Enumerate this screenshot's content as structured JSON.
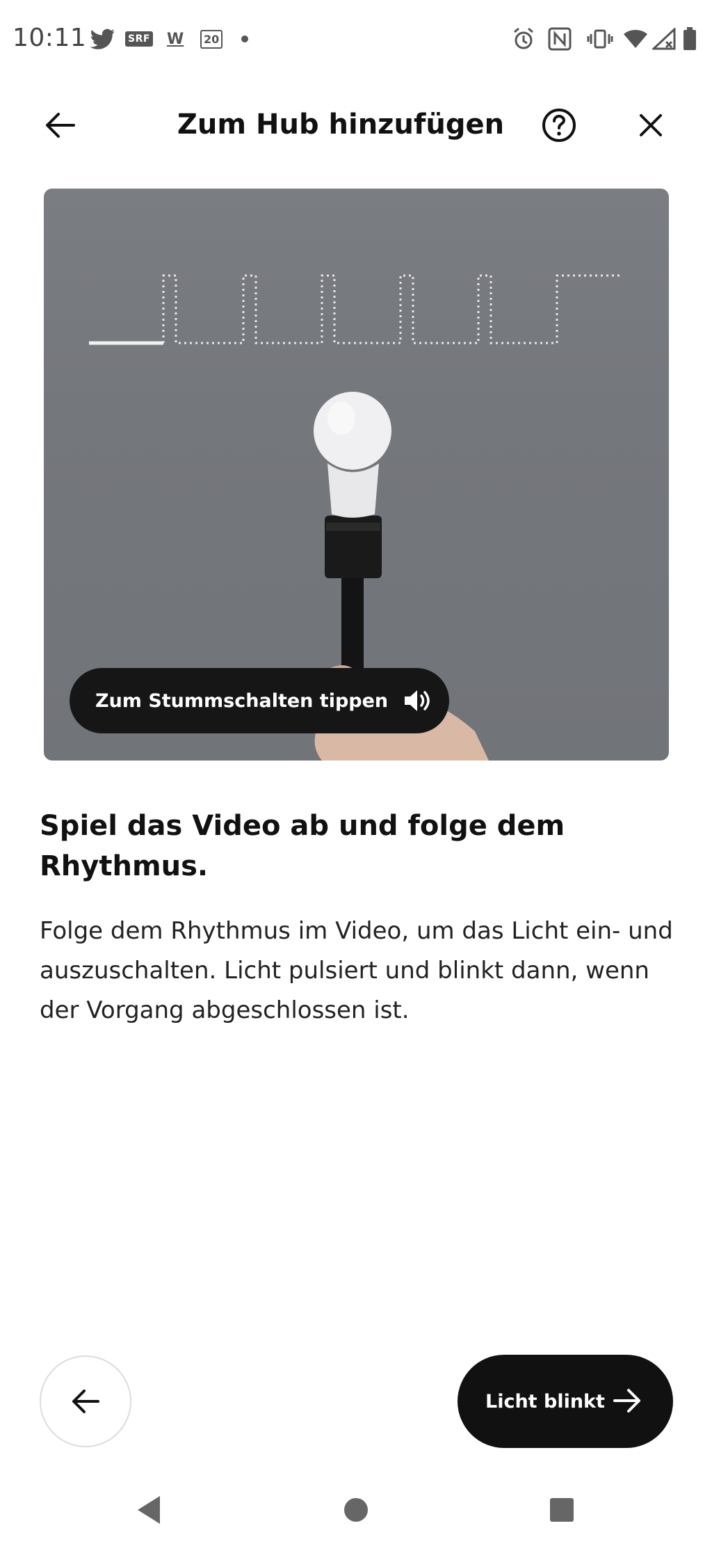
{
  "status_bar": {
    "time": "10:11",
    "notifications": [
      "twitter-icon",
      "srf-icon",
      "w-icon",
      "20min-icon",
      "dot-icon"
    ],
    "srf_label": "SRF",
    "w_label": "W",
    "twenty_label": "20",
    "system_icons": [
      "alarm-icon",
      "nfc-icon",
      "vibrate-icon",
      "wifi-icon",
      "signal-icon",
      "battery-icon"
    ]
  },
  "header": {
    "title": "Zum Hub hinzufügen",
    "back_icon": "arrow-left-icon",
    "help_icon": "help-circle-icon",
    "close_icon": "close-icon"
  },
  "video": {
    "mute_label": "Zum Stummschalten tippen",
    "speaker_icon": "speaker-icon"
  },
  "content": {
    "heading": "Spiel das Video ab und folge dem Rhythmus.",
    "body": "Folge dem Rhythmus im Video, um das Licht ein- und auszuschalten. Licht pulsiert und blinkt dann, wenn der Vorgang abgeschlossen ist."
  },
  "footer": {
    "primary_label": "Licht blinkt",
    "back_icon": "arrow-left-icon",
    "next_icon": "arrow-right-icon"
  },
  "colors": {
    "button_dark": "#111111",
    "video_bg": "#75787d",
    "text": "#111111"
  }
}
